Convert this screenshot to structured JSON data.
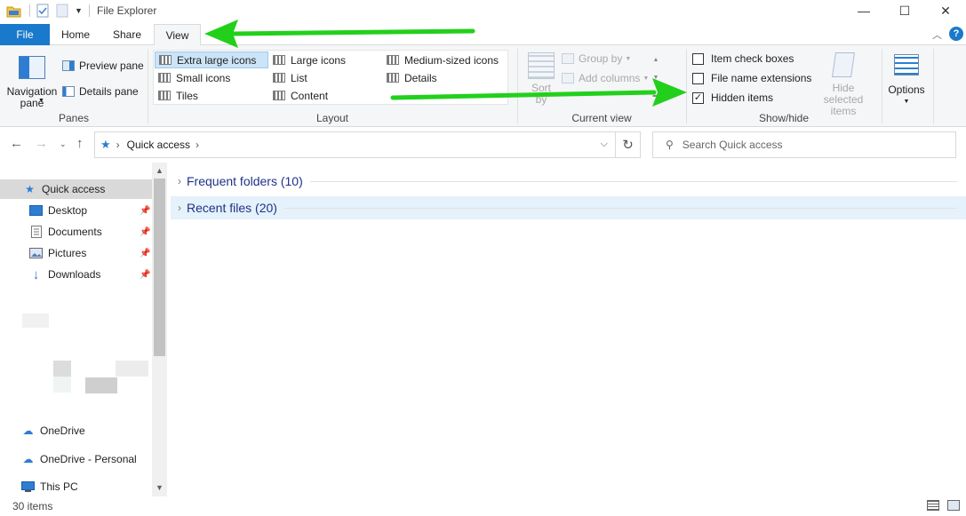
{
  "window": {
    "title": "File Explorer",
    "controls": {
      "minimize": "—",
      "maximize": "☐",
      "close": "✕"
    }
  },
  "ribbon_tabs": [
    "File",
    "Home",
    "Share",
    "View"
  ],
  "ribbon": {
    "panes": {
      "label": "Panes",
      "navigation_pane": "Navigation pane",
      "preview_pane": "Preview pane",
      "details_pane": "Details pane"
    },
    "layout": {
      "label": "Layout",
      "items": [
        "Extra large icons",
        "Large icons",
        "Medium-sized icons",
        "Small icons",
        "List",
        "Details",
        "Tiles",
        "Content"
      ],
      "selected": "Extra large icons"
    },
    "current_view": {
      "label": "Current view",
      "sort_by": "Sort by",
      "group_by": "Group by",
      "add_columns": "Add columns"
    },
    "show_hide": {
      "label": "Show/hide",
      "item_check_boxes": "Item check boxes",
      "item_check_boxes_checked": false,
      "file_name_extensions": "File name extensions",
      "file_name_extensions_checked": false,
      "hidden_items": "Hidden items",
      "hidden_items_checked": true,
      "hide_selected_items": "Hide selected items"
    },
    "options": "Options"
  },
  "address": {
    "path": "Quick access",
    "search_placeholder": "Search Quick access"
  },
  "nav_pane": {
    "items": [
      {
        "label": "Quick access",
        "icon": "star-icon",
        "selected": true
      },
      {
        "label": "Desktop",
        "icon": "desktop-icon",
        "pinned": true
      },
      {
        "label": "Documents",
        "icon": "documents-icon",
        "pinned": true
      },
      {
        "label": "Pictures",
        "icon": "pictures-icon",
        "pinned": true
      },
      {
        "label": "Downloads",
        "icon": "downloads-icon",
        "pinned": true
      },
      {
        "label": "OneDrive",
        "icon": "cloud-icon"
      },
      {
        "label": "OneDrive - Personal",
        "icon": "cloud-icon"
      },
      {
        "label": "This PC",
        "icon": "computer-icon"
      }
    ]
  },
  "content": {
    "groups": [
      {
        "label": "Frequent folders (10)"
      },
      {
        "label": "Recent files (20)"
      }
    ]
  },
  "status": {
    "count": "30 items"
  },
  "colors": {
    "accent": "#1979ca",
    "arrow": "#22d01c",
    "selected": "#cce4f7"
  }
}
